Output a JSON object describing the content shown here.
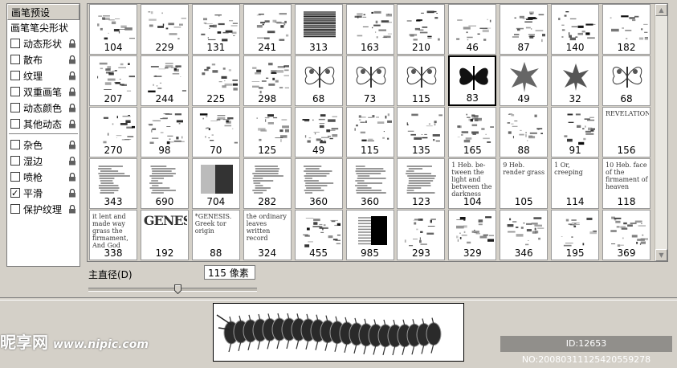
{
  "options_panel": {
    "header": "画笔预设",
    "tip_shape": "画笔笔尖形状",
    "items": [
      {
        "label": "动态形状",
        "checked": false
      },
      {
        "label": "散布",
        "checked": false
      },
      {
        "label": "纹理",
        "checked": false
      },
      {
        "label": "双重画笔",
        "checked": false
      },
      {
        "label": "动态颜色",
        "checked": false
      },
      {
        "label": "其他动态",
        "checked": false
      },
      {
        "label": "杂色",
        "checked": false
      },
      {
        "label": "湿边",
        "checked": false
      },
      {
        "label": "喷枪",
        "checked": false
      },
      {
        "label": "平滑",
        "checked": true
      },
      {
        "label": "保护纹理",
        "checked": false
      }
    ]
  },
  "brush_grid": {
    "selected_index": 18,
    "sizes": [
      "104",
      "229",
      "131",
      "241",
      "313",
      "163",
      "210",
      "46",
      "87",
      "140",
      "182",
      "207",
      "244",
      "225",
      "298",
      "68",
      "73",
      "115",
      "83",
      "49",
      "32",
      "68",
      "270",
      "98",
      "70",
      "125",
      "49",
      "115",
      "135",
      "165",
      "88",
      "91",
      "156",
      "343",
      "690",
      "704",
      "282",
      "360",
      "360",
      "123",
      "104",
      "105",
      "114",
      "118",
      "338",
      "192",
      "88",
      "324",
      "455",
      "985",
      "293",
      "329",
      "346",
      "195",
      "369"
    ],
    "text_snippets": {
      "40": "1 Heb. be-tween the light and between the darkness",
      "41": "9 Heb. render grass",
      "42": "1 Or, creeping",
      "43": "10 Heb. face of the firmament of heaven",
      "44": "it lent and made way grass the firmament, And God said, Let...",
      "45": "GENESIS",
      "46": "*GENESIS. Greek tor origin",
      "47": "the ordinary leaves written record",
      "32": "REVELATION"
    }
  },
  "diameter": {
    "label": "主直径(D)",
    "value": "115 像素",
    "slider_fraction": 0.53
  },
  "watermark": {
    "logo": "昵享网",
    "url": "www.nipic.com",
    "id_text": "ID:12653 NO:20080311125420559278"
  },
  "colors": {
    "panel_bg": "#d4d0c8",
    "cell_bg": "#ffffff",
    "selected_border": "#000000"
  }
}
